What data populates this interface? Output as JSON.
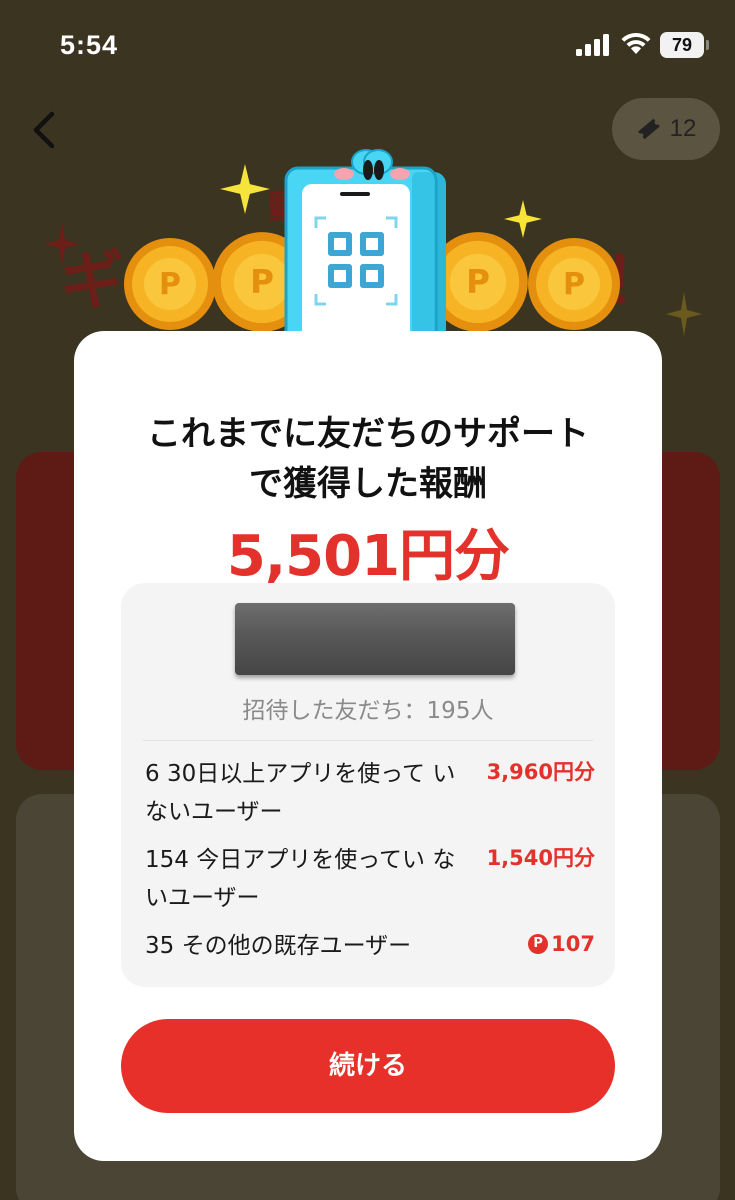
{
  "status_bar": {
    "time": "5:54",
    "battery": "79"
  },
  "header": {
    "ticket_count": "12"
  },
  "modal": {
    "title": "これまでに友だちのサポート\nで獲得した報酬",
    "amount": "5,501円分",
    "invited_friends": "招待した友だち：195人",
    "breakdown": [
      {
        "label": "6 30日以上アプリを使って いないユーザー",
        "value": "3,960円分",
        "icon": ""
      },
      {
        "label": "154 今日アプリを使ってい ないユーザー",
        "value": "1,540円分",
        "icon": ""
      },
      {
        "label": "35 その他の既存ユーザー",
        "value": "107",
        "icon": "P"
      }
    ],
    "continue_label": "続ける"
  },
  "colors": {
    "accent_red": "#e3312b",
    "button_red": "#e63029",
    "dim_overlay": "#3b3420",
    "coin_gold": "#f2a818",
    "mascot_cyan": "#3fd2f2"
  },
  "icons": {
    "back": "chevron-left-icon",
    "ticket": "ticket-icon",
    "point": "point-icon"
  }
}
